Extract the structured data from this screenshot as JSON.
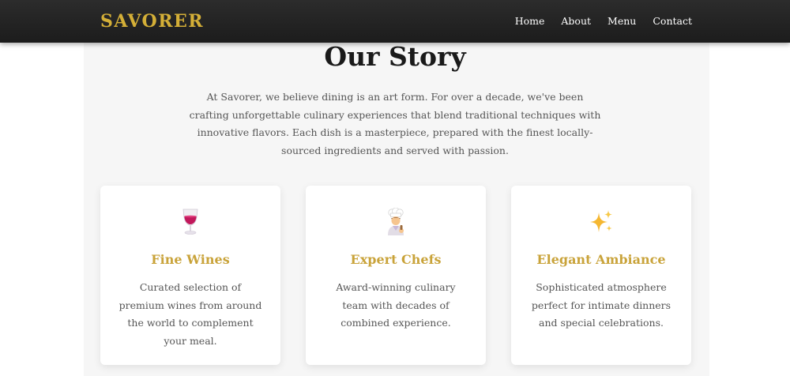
{
  "brand": {
    "name": "SAVORER"
  },
  "nav": {
    "items": [
      {
        "label": "Home"
      },
      {
        "label": "About"
      },
      {
        "label": "Menu"
      },
      {
        "label": "Contact"
      }
    ]
  },
  "story": {
    "title": "Our Story",
    "intro": "At Savorer, we believe dining is an art form. For over a decade, we've been crafting unforgettable culinary experiences that blend traditional techniques with innovative flavors. Each dish is a masterpiece, prepared with the finest locally-sourced ingredients and served with passion."
  },
  "features": [
    {
      "icon": "wine-glass-icon",
      "title": "Fine Wines",
      "text": "Curated selection of premium wines from around the world to complement your meal."
    },
    {
      "icon": "chef-icon",
      "title": "Expert Chefs",
      "text": "Award-winning culinary team with decades of combined experience."
    },
    {
      "icon": "sparkles-icon",
      "title": "Elegant Ambiance",
      "text": "Sophisticated atmosphere perfect for intimate dinners and special celebrations."
    }
  ],
  "colors": {
    "accent": "#d4af37",
    "feature_title": "#c9a33a",
    "navbar": "#222222",
    "body_text": "#555555",
    "heading": "#1a1a1a"
  }
}
